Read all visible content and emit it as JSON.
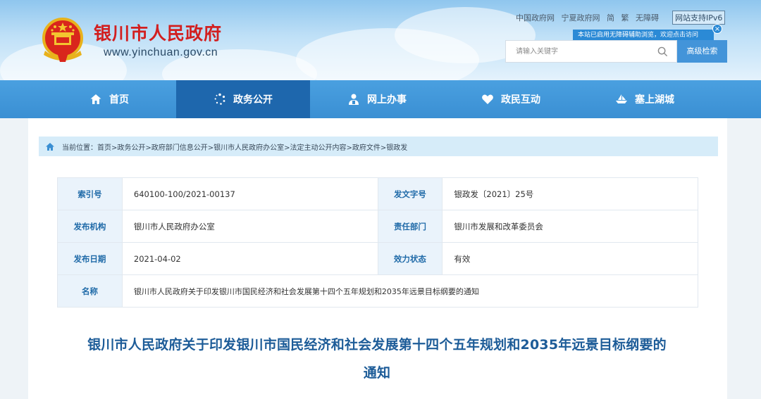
{
  "header": {
    "site_title": "银川市人民政府",
    "site_url": "www.yinchuan.gov.cn",
    "links": [
      "中国政府网",
      "宁夏政府网",
      "简",
      "繁",
      "无障碍"
    ],
    "ipv6_badge": "网站支持IPv6",
    "accessibility_tip": "本站已启用无障碍辅助浏览，欢迎点击访问",
    "search_placeholder": "请输入关键字",
    "advanced_search": "高级检索"
  },
  "nav": {
    "items": [
      {
        "label": "首页",
        "icon": "home-icon"
      },
      {
        "label": "政务公开",
        "icon": "dots-circle-icon",
        "active": true
      },
      {
        "label": "网上办事",
        "icon": "person-icon"
      },
      {
        "label": "政民互动",
        "icon": "heart-icon"
      },
      {
        "label": "塞上湖城",
        "icon": "boat-icon"
      }
    ]
  },
  "breadcrumb": {
    "prefix": "当前位置：",
    "text": "首页>政务公开>政府部门信息公开>银川市人民政府办公室>法定主动公开内容>政府文件>银政发"
  },
  "info": {
    "index_label": "索引号",
    "index_value": "640100-100/2021-00137",
    "doc_no_label": "发文字号",
    "doc_no_value": "银政发〔2021〕25号",
    "issuer_label": "发布机构",
    "issuer_value": "银川市人民政府办公室",
    "dept_label": "责任部门",
    "dept_value": "银川市发展和改革委员会",
    "date_label": "发布日期",
    "date_value": "2021-04-02",
    "status_label": "效力状态",
    "status_value": "有效",
    "name_label": "名称",
    "name_value": "银川市人民政府关于印发银川市国民经济和社会发展第十四个五年规划和2035年远景目标纲要的通知"
  },
  "document": {
    "title_line1": "银川市人民政府关于印发银川市国民经济和社会发展第十四个五年规划和2035年远景目标纲要的",
    "title_line2": "通知"
  },
  "colors": {
    "nav_bg": "#3a8fd3",
    "nav_active": "#1e67ad",
    "title_red": "#d21f1f",
    "doc_title_blue": "#1d5c98"
  }
}
